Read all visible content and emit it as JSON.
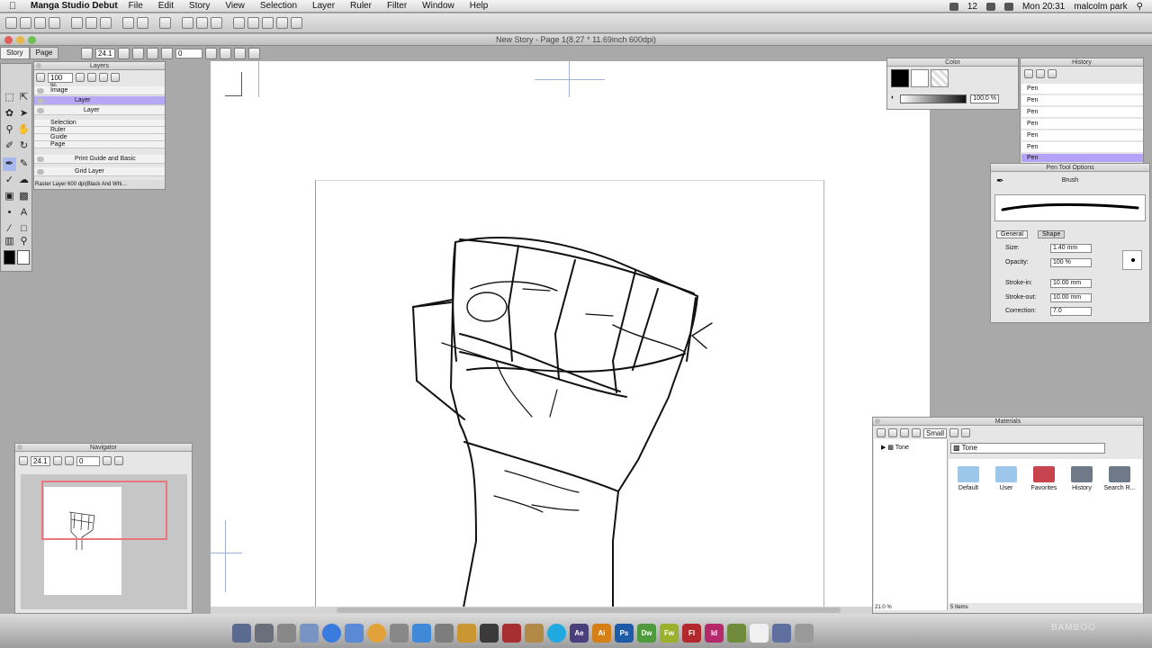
{
  "menubar": {
    "app_name": "Manga Studio Debut",
    "menus": [
      "File",
      "Edit",
      "Story",
      "View",
      "Selection",
      "Layer",
      "Ruler",
      "Filter",
      "Window",
      "Help"
    ],
    "status_number": "12",
    "clock": "Mon 20:31",
    "user": "malcolm park"
  },
  "window": {
    "title": "New Story - Page 1(8.27 * 11.69inch 600dpi)"
  },
  "tabs": [
    "Story",
    "Page"
  ],
  "canvas_toolbar": {
    "zoom": "24.1",
    "rotation": "0"
  },
  "layers": {
    "title": "Layers",
    "opacity": "100 %",
    "rows": [
      {
        "label": "Image"
      },
      {
        "label": "Layer",
        "selected": true
      },
      {
        "label": "Layer"
      },
      {
        "label": "Selection"
      },
      {
        "label": "Ruler"
      },
      {
        "label": "Guide"
      },
      {
        "label": "Page"
      },
      {
        "label": "Print Guide and Basic"
      },
      {
        "label": "Grid Layer"
      }
    ],
    "status": "Raster Layer 600 dpi(Black And Whi..."
  },
  "navigator": {
    "title": "Navigator",
    "zoom": "24.1",
    "rotation": "0"
  },
  "color": {
    "title": "Color",
    "opacity_value": "100.0 %"
  },
  "history": {
    "title": "History",
    "items": [
      "Pen",
      "Pen",
      "Pen",
      "Pen",
      "Pen",
      "Pen",
      "Pen"
    ]
  },
  "tool_property": {
    "title": "Pen Tool Options",
    "brush_label": "Brush",
    "tabs": [
      "General",
      "Shape"
    ],
    "rows": [
      {
        "label": "Size:",
        "value": "1.40 mm"
      },
      {
        "label": "Opacity:",
        "value": "100 %"
      },
      {
        "label": "Stroke-in:",
        "value": "10.00 mm"
      },
      {
        "label": "Stroke-out:",
        "value": "10.00 mm"
      },
      {
        "label": "Correction:",
        "value": "7.0"
      }
    ]
  },
  "materials": {
    "title": "Materials",
    "view_mode": "Small",
    "tree_item": "Tone",
    "folder_select": "Tone",
    "items": [
      "Default",
      "User",
      "Favorites",
      "History",
      "Search R..."
    ],
    "footer_zoom": "21.0 %",
    "footer_count": "5 Items"
  },
  "dock": {
    "apps": [
      "Ae",
      "Ai",
      "Ps",
      "Dw",
      "Fw",
      "Fl",
      "Id"
    ]
  },
  "watermark": "BAMBOO"
}
